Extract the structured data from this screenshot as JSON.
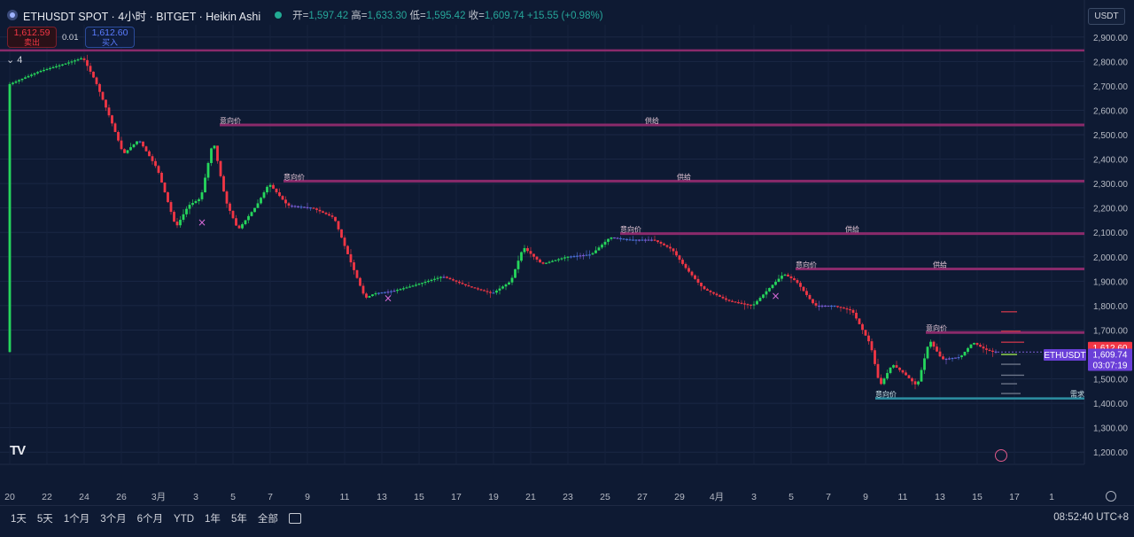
{
  "header": {
    "symbol": "ETHUSDT SPOT · 4小时 · BITGET · Heikin Ashi",
    "ohlc_open_label": "开=",
    "ohlc_open": "1,597.42",
    "ohlc_high_label": "高=",
    "ohlc_high": "1,633.30",
    "ohlc_low_label": "低=",
    "ohlc_low": "1,595.42",
    "ohlc_close_label": "收=",
    "ohlc_close": "1,609.74",
    "ohlc_change": "+15.55 (+0.98%)"
  },
  "trade": {
    "sell_price": "1,612.59",
    "sell_label": "卖出",
    "spread": "0.01",
    "buy_price": "1,612.60",
    "buy_label": "买入"
  },
  "indicators_toggle": "4",
  "currency": "USDT",
  "colors": {
    "background": "#0e1a33",
    "up": "#26d65c",
    "down": "#f23645",
    "neutral": "#7b5cd6",
    "blue": "#4a6fd6",
    "supply_line": "#8a2a6b",
    "demand_line": "#2d8fa3",
    "grid": "#1a2744"
  },
  "chart_data": {
    "type": "candlestick",
    "chart_style": "Heikin Ashi",
    "ylim": [
      1150,
      2950
    ],
    "y_ticks": [
      2900,
      2800,
      2700,
      2600,
      2500,
      2400,
      2300,
      2200,
      2100,
      2000,
      1900,
      1800,
      1700,
      1600,
      1500,
      1400,
      1300,
      1200
    ],
    "y_tick_labels": [
      "2,900.00",
      "2,800.00",
      "2,700.00",
      "2,600.00",
      "2,500.00",
      "2,400.00",
      "2,300.00",
      "2,200.00",
      "2,100.00",
      "2,000.00",
      "1,900.00",
      "1,800.00",
      "1,700.00",
      "1,600.00",
      "1,500.00",
      "1,400.00",
      "1,300.00",
      "1,200.00"
    ],
    "x_tick_labels": [
      "20",
      "22",
      "24",
      "26",
      "3月",
      "3",
      "5",
      "7",
      "9",
      "11",
      "13",
      "15",
      "17",
      "19",
      "21",
      "23",
      "25",
      "27",
      "29",
      "4月",
      "3",
      "5",
      "7",
      "9",
      "11",
      "13",
      "15",
      "17",
      "1"
    ],
    "x_tick_index": [
      0,
      12,
      24,
      36,
      48,
      60,
      72,
      84,
      96,
      108,
      120,
      132,
      144,
      156,
      168,
      180,
      192,
      204,
      216,
      228,
      240,
      252,
      264,
      276,
      288,
      300,
      312,
      324,
      336
    ],
    "price_path": [
      [
        0,
        2705
      ],
      [
        10,
        2760
      ],
      [
        18,
        2790
      ],
      [
        24,
        2815
      ],
      [
        28,
        2720
      ],
      [
        33,
        2560
      ],
      [
        37,
        2420
      ],
      [
        42,
        2480
      ],
      [
        48,
        2360
      ],
      [
        54,
        2120
      ],
      [
        58,
        2210
      ],
      [
        62,
        2240
      ],
      [
        66,
        2480
      ],
      [
        70,
        2230
      ],
      [
        74,
        2110
      ],
      [
        80,
        2210
      ],
      [
        84,
        2300
      ],
      [
        90,
        2210
      ],
      [
        98,
        2200
      ],
      [
        105,
        2160
      ],
      [
        110,
        1990
      ],
      [
        115,
        1830
      ],
      [
        118,
        1850
      ],
      [
        124,
        1860
      ],
      [
        130,
        1880
      ],
      [
        140,
        1920
      ],
      [
        148,
        1880
      ],
      [
        156,
        1850
      ],
      [
        162,
        1900
      ],
      [
        166,
        2040
      ],
      [
        172,
        1970
      ],
      [
        180,
        2000
      ],
      [
        188,
        2010
      ],
      [
        194,
        2080
      ],
      [
        200,
        2070
      ],
      [
        208,
        2070
      ],
      [
        214,
        2030
      ],
      [
        218,
        1960
      ],
      [
        224,
        1870
      ],
      [
        232,
        1820
      ],
      [
        240,
        1800
      ],
      [
        246,
        1880
      ],
      [
        250,
        1930
      ],
      [
        254,
        1900
      ],
      [
        260,
        1800
      ],
      [
        266,
        1800
      ],
      [
        272,
        1780
      ],
      [
        278,
        1640
      ],
      [
        281,
        1470
      ],
      [
        285,
        1560
      ],
      [
        289,
        1520
      ],
      [
        293,
        1470
      ],
      [
        297,
        1660
      ],
      [
        301,
        1580
      ],
      [
        307,
        1590
      ],
      [
        311,
        1650
      ],
      [
        315,
        1620
      ],
      [
        318,
        1610
      ]
    ],
    "supply_zones": [
      {
        "price": 2540,
        "intent_label": "意向价",
        "zone_label": "供给"
      },
      {
        "price": 2310,
        "intent_label": "意向价",
        "zone_label": "供给"
      },
      {
        "price": 2095,
        "intent_label": "意向价",
        "zone_label": "供给"
      },
      {
        "price": 1950,
        "intent_label": "意向价",
        "zone_label": "供给"
      },
      {
        "price": 1690,
        "intent_label": "意向价",
        "zone_label": ""
      }
    ],
    "demand_zones": [
      {
        "price": 1420,
        "intent_label": "意向价",
        "zone_label": "需求"
      }
    ],
    "top_line_price": 2845,
    "markers": [
      {
        "type": "x",
        "x_index": 62,
        "price": 2140
      },
      {
        "type": "x",
        "x_index": 122,
        "price": 1830
      },
      {
        "type": "x",
        "x_index": 247,
        "price": 1840
      }
    ],
    "price_labels": {
      "ask": "1,612.60",
      "symbol": "ETHUSDT",
      "last": "1,609.74",
      "countdown": "03:07:19"
    }
  },
  "bottom_bar": {
    "ranges": [
      "1天",
      "5天",
      "1个月",
      "3个月",
      "6个月",
      "YTD",
      "1年",
      "5年",
      "全部"
    ],
    "clock": "08:52:40 UTC+8"
  },
  "logo_text": "TV"
}
